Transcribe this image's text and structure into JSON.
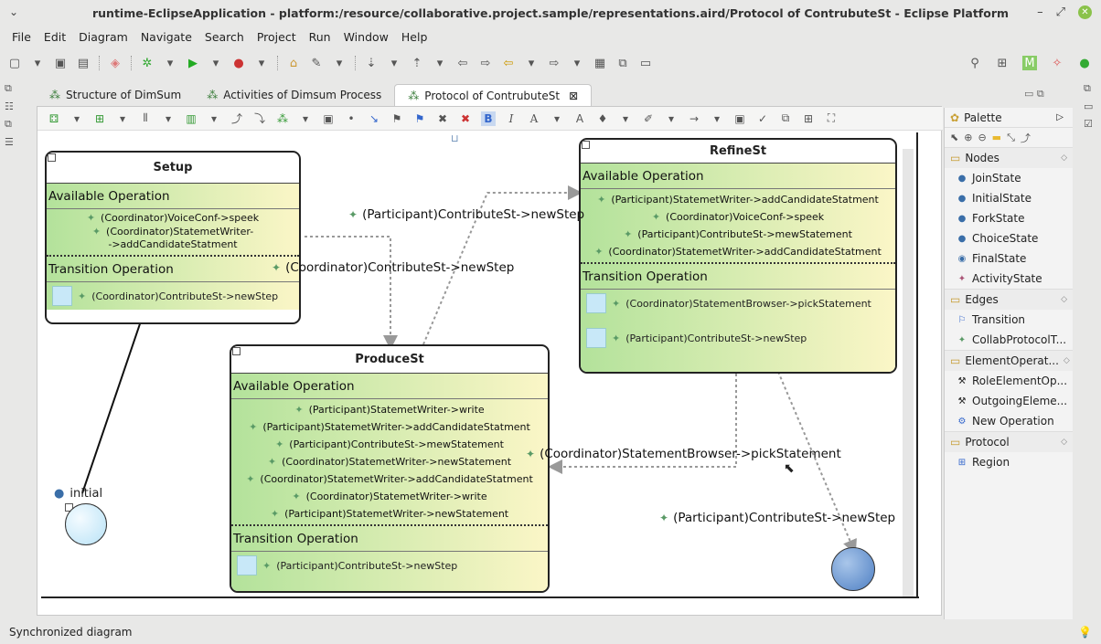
{
  "window": {
    "title": "runtime-EclipseApplication - platform:/resource/collaborative.project.sample/representations.aird/Protocol of ContrubuteSt - Eclipse Platform"
  },
  "menu": [
    "File",
    "Edit",
    "Diagram",
    "Navigate",
    "Search",
    "Project",
    "Run",
    "Window",
    "Help"
  ],
  "tabs": [
    {
      "label": "Structure of DimSum"
    },
    {
      "label": "Activities of Dimsum Process"
    },
    {
      "label": "Protocol of ContrubuteSt",
      "close": "⊠"
    }
  ],
  "diagram": {
    "setup": {
      "title": "Setup",
      "available_label": "Available Operation",
      "available": [
        "(Coordinator)VoiceConf->speek",
        "(Coordinator)StatemetWriter-",
        "->addCandidateStatment"
      ],
      "transition_label": "Transition Operation",
      "transition": [
        "(Coordinator)ContributeSt->newStep"
      ]
    },
    "produce": {
      "title": "ProduceSt",
      "available_label": "Available Operation",
      "available": [
        "(Participant)StatemetWriter->write",
        "(Participant)StatemetWriter->addCandidateStatment",
        "(Participant)ContributeSt->mewStatement",
        "(Coordinator)StatemetWriter->newStatement",
        "(Coordinator)StatemetWriter->addCandidateStatment",
        "(Coordinator)StatemetWriter->write",
        "(Participant)StatemetWriter->newStatement"
      ],
      "transition_label": "Transition Operation",
      "transition": [
        "(Participant)ContributeSt->newStep"
      ]
    },
    "refine": {
      "title": "RefineSt",
      "available_label": "Available Operation",
      "available": [
        "(Participant)StatemetWriter->addCandidateStatment",
        "(Coordinator)VoiceConf->speek",
        "(Participant)ContributeSt->mewStatement",
        "(Coordinator)StatemetWriter->addCandidateStatment"
      ],
      "transition_label": "Transition Operation",
      "transition": [
        "(Coordinator)StatementBrowser->pickStatement",
        "(Participant)ContributeSt->newStep"
      ]
    },
    "edge_labels": {
      "e1": "(Participant)ContributeSt->newStep",
      "e2": "(Coordinator)ContributeSt->newStep",
      "e3": "(Coordinator)StatementBrowser->pickStatement",
      "e4": "(Participant)ContributeSt->newStep"
    },
    "initial_label": "initial"
  },
  "palette": {
    "title": "Palette",
    "drawers": [
      {
        "name": "Nodes",
        "items": [
          "JoinState",
          "InitialState",
          "ForkState",
          "ChoiceState",
          "FinalState",
          "ActivityState"
        ]
      },
      {
        "name": "Edges",
        "items": [
          "Transition",
          "CollabProtocolT..."
        ]
      },
      {
        "name": "ElementOperat...",
        "items": [
          "RoleElementOp...",
          "OutgoingEleme...",
          "New Operation"
        ]
      },
      {
        "name": "Protocol",
        "items": [
          "Region"
        ]
      }
    ]
  },
  "status": {
    "text": "Synchronized diagram"
  }
}
